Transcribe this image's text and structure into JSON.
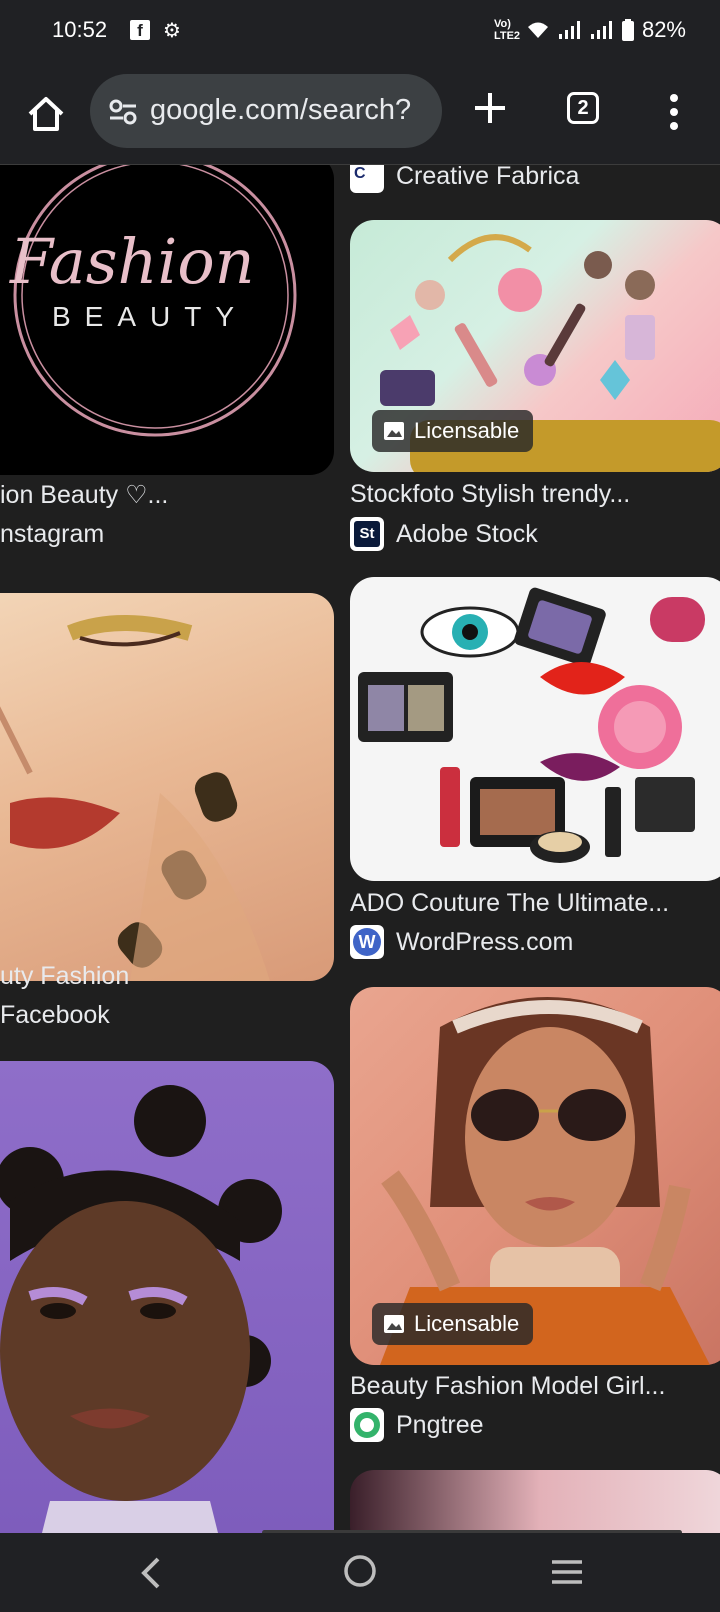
{
  "status_bar": {
    "time": "10:52",
    "battery": "82%",
    "network_label": "Vo) LTE2"
  },
  "toolbar": {
    "url": "google.com/search?",
    "tab_count": "2"
  },
  "results": [
    {
      "title": "ion Beauty ♡...",
      "source": "nstagram",
      "image_text": "Fashion",
      "image_subtext": "BEAUTY"
    },
    {
      "title": "",
      "source": "Creative Fabrica"
    },
    {
      "title": "Stockfoto Stylish trendy...",
      "source": "Adobe Stock",
      "badge": "Licensable",
      "favicon_text": "St"
    },
    {
      "title": "uty Fashion",
      "source": "Facebook"
    },
    {
      "title": "ADO Couture The Ultimate...",
      "source": "WordPress.com"
    },
    {
      "title": "Beauty Fashion Model Girl...",
      "source": "Pngtree",
      "badge": "Licensable"
    }
  ],
  "colors": {
    "background": "#1f1f1f",
    "toolbar": "#202124",
    "omnibox": "#3c4043"
  },
  "icons": [
    "home-icon",
    "tune-icon",
    "plus-icon",
    "tab-switcher-icon",
    "more-vert-icon",
    "back-icon",
    "home-circle-icon",
    "recents-icon"
  ]
}
